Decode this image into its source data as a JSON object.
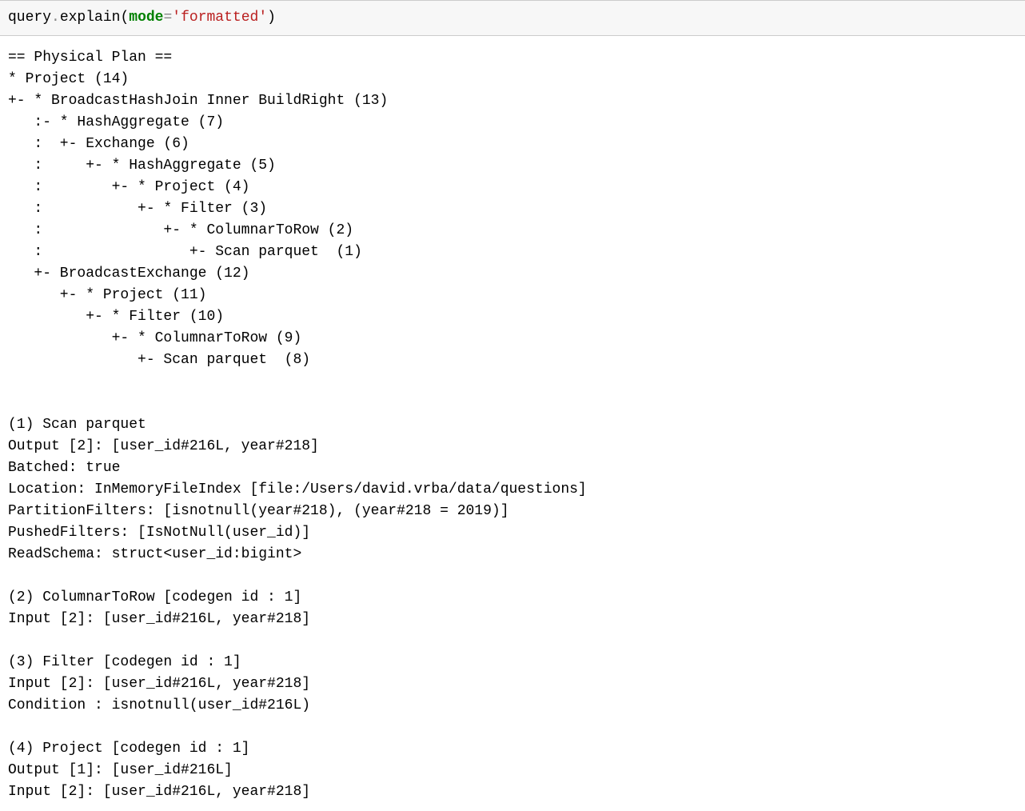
{
  "input": {
    "obj": "query",
    "dot": ".",
    "method": "explain",
    "lparen": "(",
    "arg_name": "mode",
    "eq": "=",
    "arg_value": "'formatted'",
    "rparen": ")"
  },
  "output": "== Physical Plan ==\n* Project (14)\n+- * BroadcastHashJoin Inner BuildRight (13)\n   :- * HashAggregate (7)\n   :  +- Exchange (6)\n   :     +- * HashAggregate (5)\n   :        +- * Project (4)\n   :           +- * Filter (3)\n   :              +- * ColumnarToRow (2)\n   :                 +- Scan parquet  (1)\n   +- BroadcastExchange (12)\n      +- * Project (11)\n         +- * Filter (10)\n            +- * ColumnarToRow (9)\n               +- Scan parquet  (8)\n\n\n(1) Scan parquet \nOutput [2]: [user_id#216L, year#218]\nBatched: true\nLocation: InMemoryFileIndex [file:/Users/david.vrba/data/questions]\nPartitionFilters: [isnotnull(year#218), (year#218 = 2019)]\nPushedFilters: [IsNotNull(user_id)]\nReadSchema: struct<user_id:bigint>\n\n(2) ColumnarToRow [codegen id : 1]\nInput [2]: [user_id#216L, year#218]\n\n(3) Filter [codegen id : 1]\nInput [2]: [user_id#216L, year#218]\nCondition : isnotnull(user_id#216L)\n\n(4) Project [codegen id : 1]\nOutput [1]: [user_id#216L]\nInput [2]: [user_id#216L, year#218]"
}
